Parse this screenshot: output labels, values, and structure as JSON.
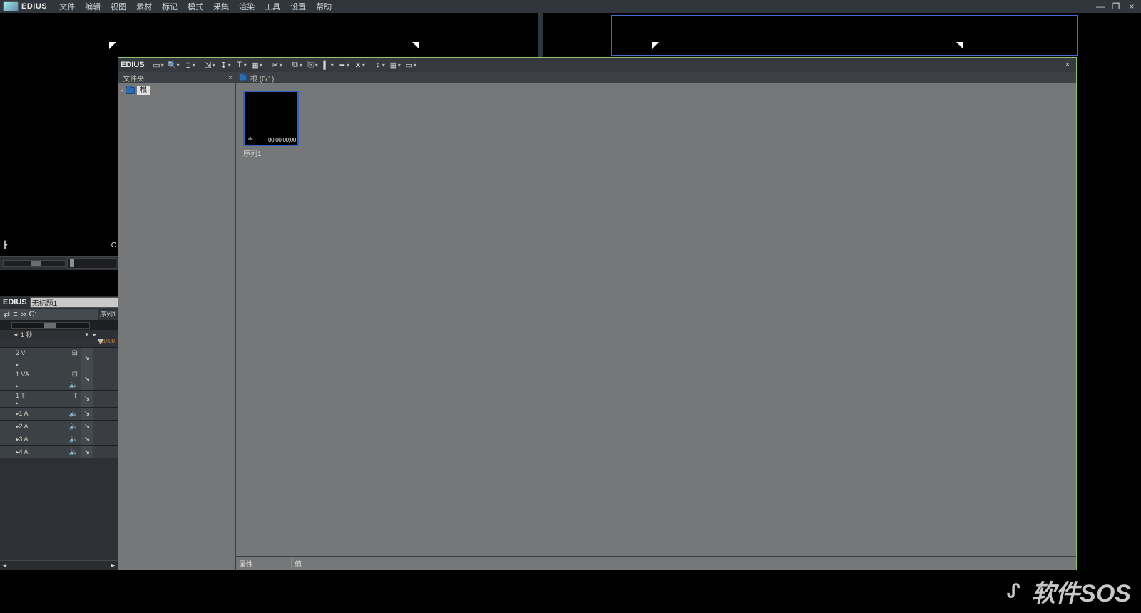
{
  "app": {
    "brand": "EDIUS"
  },
  "menu": [
    "文件",
    "编辑",
    "视图",
    "素材",
    "标记",
    "模式",
    "采集",
    "渲染",
    "工具",
    "设置",
    "帮助"
  ],
  "window_controls": {
    "minimize": "—",
    "maximize": "❐",
    "close": "×"
  },
  "bin": {
    "brand": "EDIUS",
    "folder_tab": "文件夹",
    "root_label": "根",
    "content_tab": "根 (0/1)",
    "clip": {
      "name": "序列1",
      "tc": "00:00:00;00"
    },
    "prop_col1": "属性",
    "prop_col2": "值"
  },
  "left": {
    "mark_left": "┣",
    "mark_right": "C"
  },
  "timeline": {
    "brand": "EDIUS",
    "project_name": "无标题1",
    "seq_tab": "序列1",
    "zoom_label": "1 秒",
    "ruler_tc": "|00:00",
    "tracks": [
      {
        "name": "2 V",
        "h": "h30",
        "ic": "⊟",
        "ic2": ""
      },
      {
        "name": "1 VA",
        "h": "h30",
        "ic": "⊟",
        "ic2": "🔈"
      },
      {
        "name": "1 T",
        "h": "h24",
        "ic": "T",
        "ic2": "",
        "cls": "title"
      },
      {
        "name": "▸1 A",
        "h": "h18",
        "ic": "🔈",
        "ic2": ""
      },
      {
        "name": "▸2 A",
        "h": "h18",
        "ic": "🔈",
        "ic2": ""
      },
      {
        "name": "▸3 A",
        "h": "h18",
        "ic": "🔈",
        "ic2": ""
      },
      {
        "name": "▸4 A",
        "h": "h18",
        "ic": "🔈",
        "ic2": ""
      }
    ]
  },
  "watermark": {
    "icon": "ᔑ",
    "text": "软件SOS"
  },
  "toolbar_icons": [
    {
      "n": "folder-icon",
      "g": "▭"
    },
    {
      "n": "search-icon",
      "g": "🔍"
    },
    {
      "n": "up-icon",
      "g": "↥"
    },
    {
      "n": "import-icon",
      "g": "⇲"
    },
    {
      "n": "new-seq-icon",
      "g": "↧"
    },
    {
      "n": "title-icon",
      "g": "T"
    },
    {
      "n": "clip-props-icon",
      "g": "▦"
    },
    {
      "n": "cut-icon",
      "g": "✂"
    },
    {
      "n": "copy-icon",
      "g": "⧉"
    },
    {
      "n": "paste-icon",
      "g": "⎘"
    },
    {
      "n": "delete-icon",
      "g": "▍"
    },
    {
      "n": "trim-icon",
      "g": "━"
    },
    {
      "n": "clear-icon",
      "g": "✕"
    },
    {
      "n": "sort-icon",
      "g": "↕"
    },
    {
      "n": "view-icon",
      "g": "▦"
    },
    {
      "n": "list-icon",
      "g": "▭"
    }
  ]
}
